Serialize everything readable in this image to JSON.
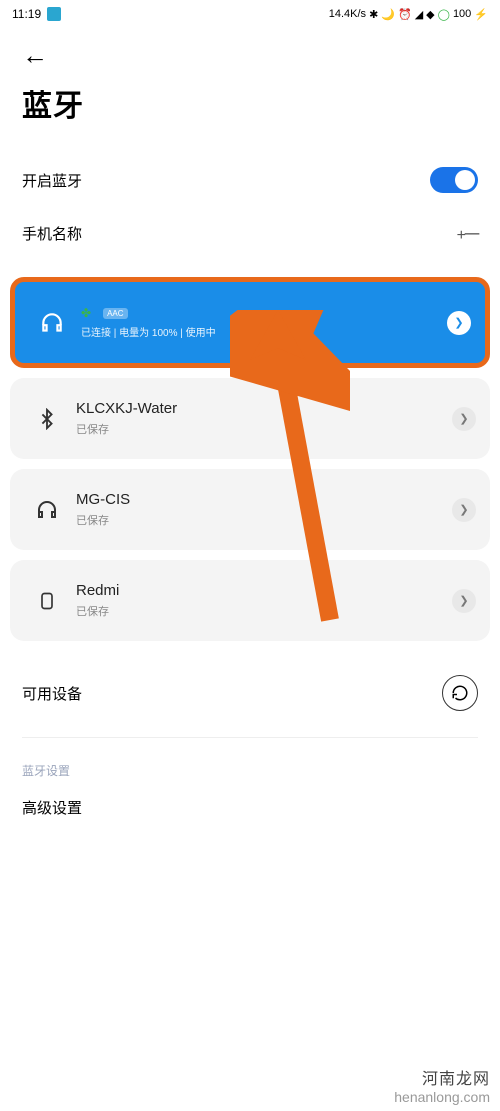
{
  "status": {
    "time": "11:19",
    "net_speed": "14.4K/s",
    "battery": "100"
  },
  "page": {
    "title": "蓝牙"
  },
  "rows": {
    "enable_bt": "开启蓝牙",
    "phone_name": "手机名称",
    "phone_name_value": "+一"
  },
  "devices": [
    {
      "name": "",
      "codec": "AAC",
      "status": "已连接 | 电量为 100% | 使用中",
      "icon": "headphones",
      "connected": true
    },
    {
      "name": "KLCXKJ-Water",
      "status": "已保存",
      "icon": "bluetooth",
      "connected": false
    },
    {
      "name": "MG-CIS",
      "status": "已保存",
      "icon": "headphones",
      "connected": false
    },
    {
      "name": "Redmi",
      "status": "已保存",
      "icon": "phone",
      "connected": false
    }
  ],
  "sections": {
    "available": "可用设备",
    "bt_settings": "蓝牙设置",
    "advanced": "高级设置"
  },
  "watermark": {
    "line1": "河南龙网",
    "line2": "henanlong.com"
  }
}
